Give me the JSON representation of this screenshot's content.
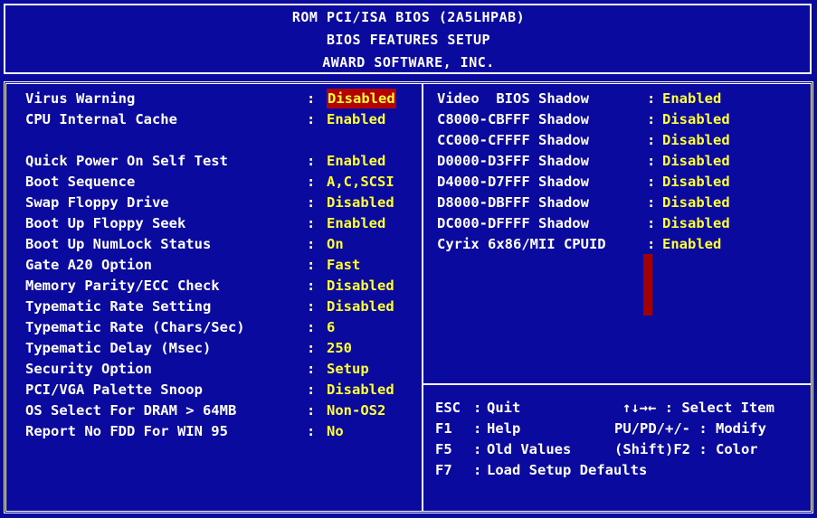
{
  "header": {
    "line1": "ROM PCI/ISA BIOS (2A5LHPAB)",
    "line2": "BIOS FEATURES SETUP",
    "line3": "AWARD SOFTWARE, INC."
  },
  "left_settings": [
    {
      "label": "Virus Warning",
      "value": "Disabled",
      "selected": true
    },
    {
      "label": "CPU Internal Cache",
      "value": "Enabled"
    },
    {
      "label": "Quick Power On Self Test",
      "value": "Enabled"
    },
    {
      "label": "Boot Sequence",
      "value": "A,C,SCSI"
    },
    {
      "label": "Swap Floppy Drive",
      "value": "Disabled"
    },
    {
      "label": "Boot Up Floppy Seek",
      "value": "Enabled"
    },
    {
      "label": "Boot Up NumLock Status",
      "value": "On"
    },
    {
      "label": "Gate A20 Option",
      "value": "Fast"
    },
    {
      "label": "Memory Parity/ECC Check",
      "value": "Disabled"
    },
    {
      "label": "Typematic Rate Setting",
      "value": "Disabled"
    },
    {
      "label": "Typematic Rate (Chars/Sec)",
      "value": "6"
    },
    {
      "label": "Typematic Delay (Msec)",
      "value": "250"
    },
    {
      "label": "Security Option",
      "value": "Setup"
    },
    {
      "label": "PCI/VGA Palette Snoop",
      "value": "Disabled"
    },
    {
      "label": "OS Select For DRAM > 64MB",
      "value": "Non-OS2"
    },
    {
      "label": "Report No FDD For WIN 95",
      "value": "No"
    }
  ],
  "right_settings": [
    {
      "label": "Video  BIOS Shadow",
      "value": "Enabled"
    },
    {
      "label": "C8000-CBFFF Shadow",
      "value": "Disabled"
    },
    {
      "label": "CC000-CFFFF Shadow",
      "value": "Disabled"
    },
    {
      "label": "D0000-D3FFF Shadow",
      "value": "Disabled"
    },
    {
      "label": "D4000-D7FFF Shadow",
      "value": "Disabled"
    },
    {
      "label": "D8000-DBFFF Shadow",
      "value": "Disabled"
    },
    {
      "label": "DC000-DFFFF Shadow",
      "value": "Disabled"
    },
    {
      "label": "Cyrix 6x86/MII CPUID",
      "value": "Enabled"
    }
  ],
  "help": {
    "esc_key": "ESC",
    "esc_text": "Quit",
    "f1_key": "F1",
    "f1_text": "Help",
    "f5_key": "F5",
    "f5_text": "Old Values",
    "f7_key": "F7",
    "f7_text": "Load Setup Defaults",
    "arrows": "↑↓→← : Select Item",
    "pupd": "PU/PD/+/- : Modify",
    "shiftf2": "(Shift)F2 : Color",
    "colon": ":"
  },
  "colors": {
    "background": "#0a0a9e",
    "label": "#ffffff",
    "value": "#ffff33",
    "highlight": "#b30000"
  }
}
